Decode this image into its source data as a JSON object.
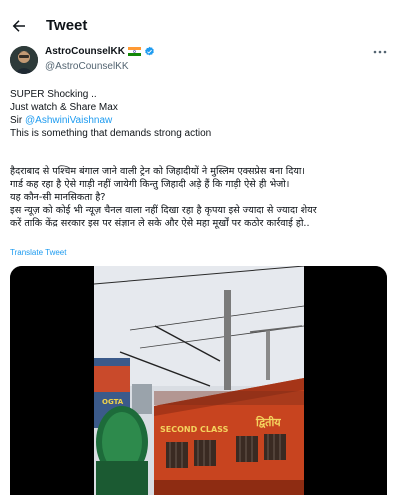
{
  "header": {
    "title": "Tweet"
  },
  "author": {
    "display_name": "AstroCounselKK",
    "handle": "@AstroCounselKK"
  },
  "tweet": {
    "line1": "SUPER Shocking ..",
    "line2": "Just watch & Share Max",
    "line3_prefix": "Sir ",
    "mention": "@AshwiniVaishnaw",
    "line4": "This is something that demands strong action",
    "hindi": [
      "हैदराबाद से पश्चिम बंगाल जाने वाली ट्रेन को जिहादीयों ने मुस्लिम एक्सप्रेस बना दिया।",
      "गार्ड कह रहा है ऐसे गाड़ी नहीं जायेगी किन्तु जिहादी अड़े हैं कि गाड़ी ऐसे ही भेजो।",
      "यह कौन-सी मानसिकता है?",
      "इस न्यूज़ को कोई भी न्यूज़ चैनल वाला नहीं दिखा रहा है कृपया इसे ज्यादा से ज्यादा शेयर",
      "करें ताकि केंद्र सरकार इस पर संज्ञान ले सके और ऐसे महा मूर्खों पर कठोर कार्रवाई हो.."
    ],
    "translate_label": "Translate Tweet"
  },
  "media": {
    "coach_label": "SECOND CLASS",
    "coach_hindi": "द्वितीय",
    "sign_text": "OGTA"
  },
  "colors": {
    "accent": "#1d9bf0",
    "text": "#0f1419",
    "muted": "#536471",
    "train": "#c8441f"
  }
}
